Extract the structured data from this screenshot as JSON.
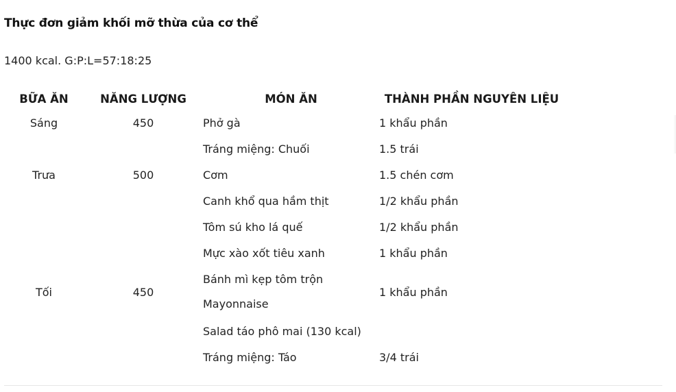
{
  "page": {
    "title": "Thực đơn giảm khối mỡ thừa của cơ thể",
    "subtitle": "1400 kcal. G:P:L=57:18:25"
  },
  "table": {
    "headers": [
      "BỮA ĂN",
      "NĂNG LƯỢNG",
      "MÓN ĂN",
      "THÀNH PHẦN NGUYÊN LIỆU"
    ],
    "breakfast": {
      "meal": "Sáng",
      "energy": "450",
      "items": [
        {
          "dish": "Phở gà",
          "amount": "1 khẩu phần"
        },
        {
          "dish": "Tráng miệng: Chuối",
          "amount": "1.5 trái"
        }
      ]
    },
    "lunch": {
      "meal": "Trưa",
      "energy": "500",
      "items": [
        {
          "dish": "Cơm",
          "amount": "1.5 chén cơm"
        },
        {
          "dish": "Canh khổ qua hầm thịt",
          "amount": "1/2 khẩu phần"
        },
        {
          "dish": "Tôm sú kho lá quế",
          "amount": "1/2 khẩu phần"
        },
        {
          "dish": "Mực xào xốt tiêu xanh",
          "amount": "1 khẩu phần"
        }
      ]
    },
    "dinner": {
      "meal": "Tối",
      "energy": "450",
      "items": [
        {
          "dish": "Bánh mì kẹp tôm trộn Mayonnaise",
          "amount": "1 khẩu phần"
        },
        {
          "dish": "Salad táo phô mai (130 kcal)",
          "amount": ""
        },
        {
          "dish": "Tráng miệng: Táo",
          "amount": "3/4 trái"
        }
      ]
    }
  }
}
